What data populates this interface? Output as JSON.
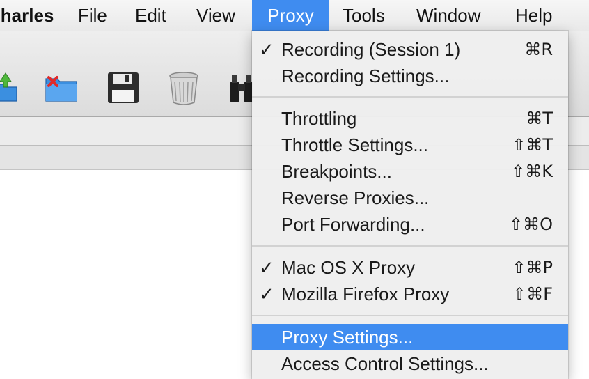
{
  "menubar": {
    "app_name": "Charles",
    "items": [
      "File",
      "Edit",
      "View",
      "Proxy",
      "Tools",
      "Window",
      "Help"
    ],
    "active": "Proxy"
  },
  "proxy_menu": {
    "items": [
      {
        "check": "✓",
        "label": "Recording (Session 1)",
        "shortcut": "⌘R"
      },
      {
        "check": "",
        "label": "Recording Settings...",
        "shortcut": ""
      },
      {
        "check": "",
        "label": "Throttling",
        "shortcut": "⌘T"
      },
      {
        "check": "",
        "label": "Throttle Settings...",
        "shortcut": "⇧⌘T"
      },
      {
        "check": "",
        "label": "Breakpoints...",
        "shortcut": "⇧⌘K"
      },
      {
        "check": "",
        "label": "Reverse Proxies...",
        "shortcut": ""
      },
      {
        "check": "",
        "label": "Port Forwarding...",
        "shortcut": "⇧⌘O"
      },
      {
        "check": "✓",
        "label": "Mac OS X Proxy",
        "shortcut": "⇧⌘P"
      },
      {
        "check": "✓",
        "label": "Mozilla Firefox Proxy",
        "shortcut": "⇧⌘F"
      },
      {
        "check": "",
        "label": "Proxy Settings...",
        "shortcut": ""
      },
      {
        "check": "",
        "label": "Access Control Settings...",
        "shortcut": ""
      }
    ],
    "highlighted": "Proxy Settings..."
  },
  "toolbar": {
    "icons": [
      "import-icon",
      "close-session-icon",
      "save-icon",
      "trash-icon",
      "binoculars-icon"
    ]
  },
  "colors": {
    "highlight": "#3f8cf0",
    "menu_bg": "#eeeeee"
  }
}
